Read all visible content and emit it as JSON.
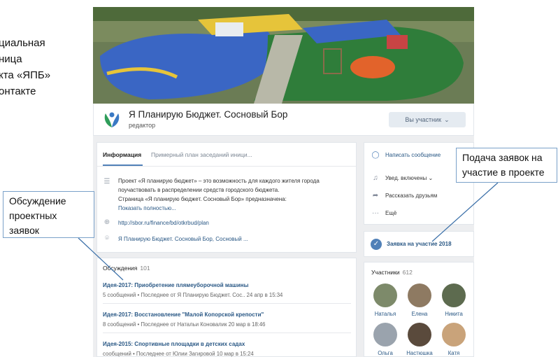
{
  "slide_caption": [
    "циальная",
    "ница",
    "кта «ЯПБ»",
    "онтакте"
  ],
  "page": {
    "title": "Я Планирую Бюджет. Сосновый Бор",
    "role": "редактор",
    "member_button": "Вы участник",
    "member_button_chevron": "⌄"
  },
  "tabs": [
    {
      "label": "Информация",
      "active": true
    },
    {
      "label": "Примерный план заседаний иници..."
    }
  ],
  "info": {
    "description_lines": [
      "Проект «Я планирую бюджет» – это возможность для каждого жителя города",
      "поучаствовать в распределении средств городского бюджета.",
      "Страница «Я планирую бюджет. Сосновый Бор» предназначена:"
    ],
    "show_more": "Показать полностью...",
    "website": "http://sbor.ru/finance/bd/otkrbud/plan",
    "address": "Я Планирую Бюджет. Сосновый Бор, Сосновый ..."
  },
  "discussions": {
    "header": "Обсуждения",
    "count": "101",
    "items": [
      {
        "title": "Идея-2017: Приобретение плямеуборочной машины",
        "meta": "5 сообщений  •  Последнее от Я Планирую Бюджет. Сос.. 24 апр в 15:34"
      },
      {
        "title": "Идея-2017: Восстановление \"Малой Копорской крепости\"",
        "meta": "8 сообщений  •  Последнее от Натальи Коновалик 20 мар в 18:46"
      },
      {
        "title": "Идея-2015: Спортивные площадки в детских садах",
        "meta": "сообщений  •  Последнее от Юлии Загировой 10 мар в 15:24"
      }
    ]
  },
  "actions": [
    {
      "label": "Написать сообщение",
      "icon": "message-icon",
      "primary": true
    },
    {
      "label": "Увед. включены  ⌄",
      "icon": "bell-icon"
    },
    {
      "label": "Рассказать друзьям",
      "icon": "share-icon"
    },
    {
      "label": "Ещё",
      "icon": "more-icon"
    }
  ],
  "apply_link": "Заявка на участие 2018",
  "members": {
    "header": "Участники",
    "count": "612",
    "people": [
      {
        "name": "Наталья",
        "color": "#7d8a6a"
      },
      {
        "name": "Елена",
        "color": "#8e7a62"
      },
      {
        "name": "Никита",
        "color": "#5d6b4f"
      },
      {
        "name": "Ольга",
        "color": "#9aa3ad"
      },
      {
        "name": "Настюшка",
        "color": "#5a4a3c"
      },
      {
        "name": "Катя",
        "color": "#c9a37a"
      }
    ]
  },
  "callouts": {
    "left": [
      "Обсуждение",
      "проектных",
      "заявок"
    ],
    "right": [
      "Подача заявок на",
      "участие в проекте"
    ]
  },
  "colors": {
    "vk_blue": "#5181b8",
    "link": "#2a5885",
    "page_bg": "#edeef0"
  }
}
